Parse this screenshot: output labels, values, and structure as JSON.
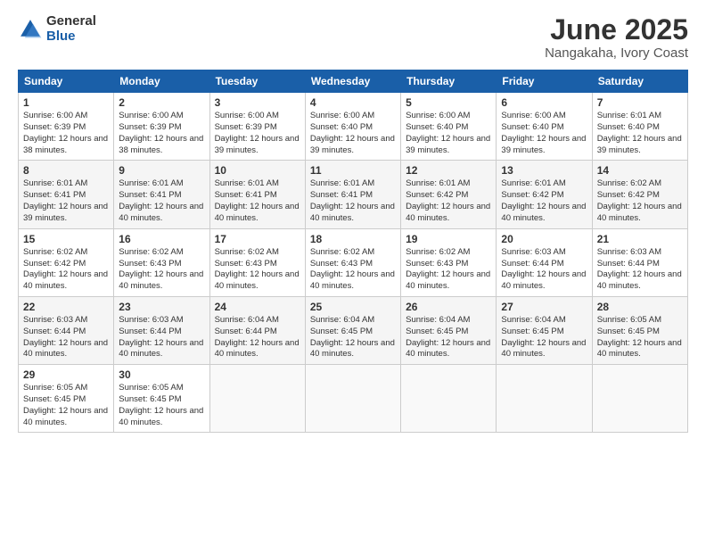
{
  "logo": {
    "general": "General",
    "blue": "Blue"
  },
  "title": "June 2025",
  "subtitle": "Nangakaha, Ivory Coast",
  "days_header": [
    "Sunday",
    "Monday",
    "Tuesday",
    "Wednesday",
    "Thursday",
    "Friday",
    "Saturday"
  ],
  "weeks": [
    [
      {
        "day": "1",
        "sunrise": "6:00 AM",
        "sunset": "6:39 PM",
        "daylight": "12 hours and 38 minutes."
      },
      {
        "day": "2",
        "sunrise": "6:00 AM",
        "sunset": "6:39 PM",
        "daylight": "12 hours and 38 minutes."
      },
      {
        "day": "3",
        "sunrise": "6:00 AM",
        "sunset": "6:39 PM",
        "daylight": "12 hours and 39 minutes."
      },
      {
        "day": "4",
        "sunrise": "6:00 AM",
        "sunset": "6:40 PM",
        "daylight": "12 hours and 39 minutes."
      },
      {
        "day": "5",
        "sunrise": "6:00 AM",
        "sunset": "6:40 PM",
        "daylight": "12 hours and 39 minutes."
      },
      {
        "day": "6",
        "sunrise": "6:00 AM",
        "sunset": "6:40 PM",
        "daylight": "12 hours and 39 minutes."
      },
      {
        "day": "7",
        "sunrise": "6:01 AM",
        "sunset": "6:40 PM",
        "daylight": "12 hours and 39 minutes."
      }
    ],
    [
      {
        "day": "8",
        "sunrise": "6:01 AM",
        "sunset": "6:41 PM",
        "daylight": "12 hours and 39 minutes."
      },
      {
        "day": "9",
        "sunrise": "6:01 AM",
        "sunset": "6:41 PM",
        "daylight": "12 hours and 40 minutes."
      },
      {
        "day": "10",
        "sunrise": "6:01 AM",
        "sunset": "6:41 PM",
        "daylight": "12 hours and 40 minutes."
      },
      {
        "day": "11",
        "sunrise": "6:01 AM",
        "sunset": "6:41 PM",
        "daylight": "12 hours and 40 minutes."
      },
      {
        "day": "12",
        "sunrise": "6:01 AM",
        "sunset": "6:42 PM",
        "daylight": "12 hours and 40 minutes."
      },
      {
        "day": "13",
        "sunrise": "6:01 AM",
        "sunset": "6:42 PM",
        "daylight": "12 hours and 40 minutes."
      },
      {
        "day": "14",
        "sunrise": "6:02 AM",
        "sunset": "6:42 PM",
        "daylight": "12 hours and 40 minutes."
      }
    ],
    [
      {
        "day": "15",
        "sunrise": "6:02 AM",
        "sunset": "6:42 PM",
        "daylight": "12 hours and 40 minutes."
      },
      {
        "day": "16",
        "sunrise": "6:02 AM",
        "sunset": "6:43 PM",
        "daylight": "12 hours and 40 minutes."
      },
      {
        "day": "17",
        "sunrise": "6:02 AM",
        "sunset": "6:43 PM",
        "daylight": "12 hours and 40 minutes."
      },
      {
        "day": "18",
        "sunrise": "6:02 AM",
        "sunset": "6:43 PM",
        "daylight": "12 hours and 40 minutes."
      },
      {
        "day": "19",
        "sunrise": "6:02 AM",
        "sunset": "6:43 PM",
        "daylight": "12 hours and 40 minutes."
      },
      {
        "day": "20",
        "sunrise": "6:03 AM",
        "sunset": "6:44 PM",
        "daylight": "12 hours and 40 minutes."
      },
      {
        "day": "21",
        "sunrise": "6:03 AM",
        "sunset": "6:44 PM",
        "daylight": "12 hours and 40 minutes."
      }
    ],
    [
      {
        "day": "22",
        "sunrise": "6:03 AM",
        "sunset": "6:44 PM",
        "daylight": "12 hours and 40 minutes."
      },
      {
        "day": "23",
        "sunrise": "6:03 AM",
        "sunset": "6:44 PM",
        "daylight": "12 hours and 40 minutes."
      },
      {
        "day": "24",
        "sunrise": "6:04 AM",
        "sunset": "6:44 PM",
        "daylight": "12 hours and 40 minutes."
      },
      {
        "day": "25",
        "sunrise": "6:04 AM",
        "sunset": "6:45 PM",
        "daylight": "12 hours and 40 minutes."
      },
      {
        "day": "26",
        "sunrise": "6:04 AM",
        "sunset": "6:45 PM",
        "daylight": "12 hours and 40 minutes."
      },
      {
        "day": "27",
        "sunrise": "6:04 AM",
        "sunset": "6:45 PM",
        "daylight": "12 hours and 40 minutes."
      },
      {
        "day": "28",
        "sunrise": "6:05 AM",
        "sunset": "6:45 PM",
        "daylight": "12 hours and 40 minutes."
      }
    ],
    [
      {
        "day": "29",
        "sunrise": "6:05 AM",
        "sunset": "6:45 PM",
        "daylight": "12 hours and 40 minutes."
      },
      {
        "day": "30",
        "sunrise": "6:05 AM",
        "sunset": "6:45 PM",
        "daylight": "12 hours and 40 minutes."
      },
      null,
      null,
      null,
      null,
      null
    ]
  ]
}
